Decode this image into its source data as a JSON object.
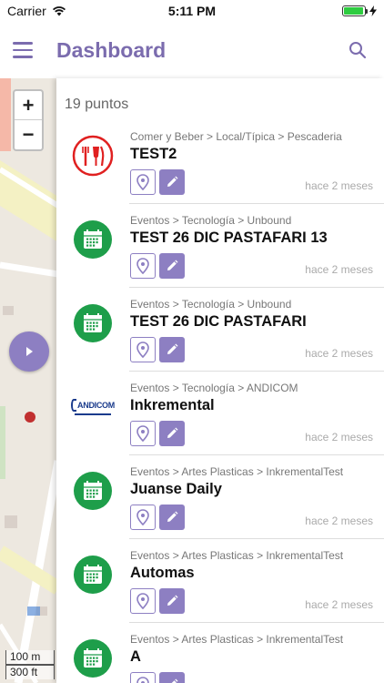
{
  "status": {
    "carrier": "Carrier",
    "time": "5:11 PM",
    "battery_level": 0.95
  },
  "navbar": {
    "title": "Dashboard"
  },
  "map": {
    "zoom_in": "+",
    "zoom_out": "−",
    "scale_m": "100 m",
    "scale_ft": "300 ft"
  },
  "list": {
    "count": "19 puntos",
    "items": [
      {
        "crumb": "Comer y Beber > Local/Típica > Pescaderia",
        "title": "TEST2",
        "time": "hace 2 meses",
        "icon": "restaurant-icon"
      },
      {
        "crumb": "Eventos > Tecnología > Unbound",
        "title": "TEST 26 DIC PASTAFARI 13",
        "time": "hace 2 meses",
        "icon": "calendar-icon"
      },
      {
        "crumb": "Eventos > Tecnología > Unbound",
        "title": "TEST 26 DIC PASTAFARI",
        "time": "hace 2 meses",
        "icon": "calendar-icon"
      },
      {
        "crumb": "Eventos > Tecnología > ANDICOM",
        "title": "Inkremental",
        "time": "hace 2 meses",
        "icon": "andicom-logo",
        "logo_text": "ANDICOM"
      },
      {
        "crumb": "Eventos > Artes Plasticas > InkrementalTest",
        "title": "Juanse Daily",
        "time": "hace 2 meses",
        "icon": "calendar-icon"
      },
      {
        "crumb": "Eventos > Artes Plasticas > InkrementalTest",
        "title": "Automas",
        "time": "hace 2 meses",
        "icon": "calendar-icon"
      },
      {
        "crumb": "Eventos > Artes Plasticas > InkrementalTest",
        "title": "A",
        "time": "",
        "icon": "calendar-icon"
      }
    ]
  },
  "colors": {
    "accent": "#7b6cae",
    "button": "#8d7fc2",
    "event_green": "#1e9e4a",
    "food_red": "#e02020"
  }
}
